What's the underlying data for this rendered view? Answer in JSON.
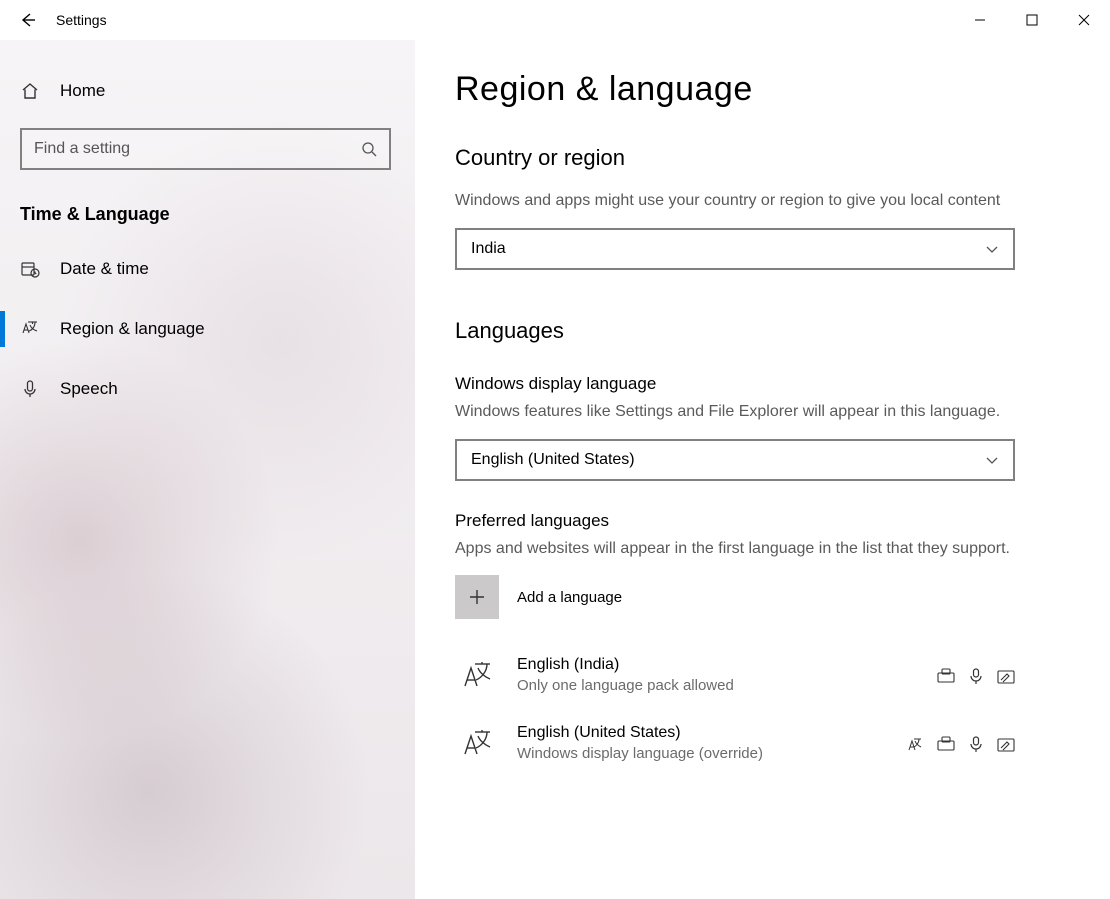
{
  "titlebar": {
    "title": "Settings"
  },
  "sidebar": {
    "home_label": "Home",
    "search_placeholder": "Find a setting",
    "group_title": "Time & Language",
    "items": [
      {
        "label": "Date & time",
        "active": false
      },
      {
        "label": "Region & language",
        "active": true
      },
      {
        "label": "Speech",
        "active": false
      }
    ]
  },
  "main": {
    "page_title": "Region & language",
    "region": {
      "heading": "Country or region",
      "desc": "Windows and apps might use your country or region to give you local content",
      "selected": "India"
    },
    "languages": {
      "heading": "Languages",
      "display": {
        "label": "Windows display language",
        "desc": "Windows features like Settings and File Explorer will appear in this language.",
        "selected": "English (United States)"
      },
      "preferred": {
        "label": "Preferred languages",
        "desc": "Apps and websites will appear in the first language in the list that they support.",
        "add_label": "Add a language",
        "list": [
          {
            "name": "English (India)",
            "sub": "Only one language pack allowed"
          },
          {
            "name": "English (United States)",
            "sub": "Windows display language (override)"
          }
        ]
      }
    }
  }
}
